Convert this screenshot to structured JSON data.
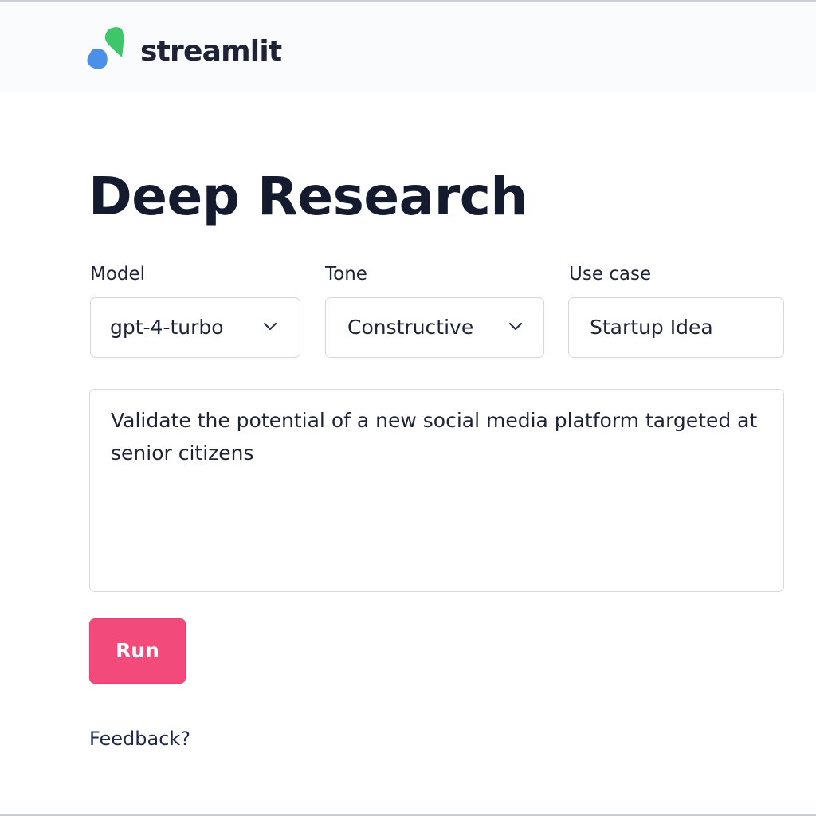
{
  "header": {
    "brand": "streamlit",
    "logo_icon": "streamlit-logo-icon",
    "logo_colors": [
      "#3ec66b",
      "#4a8fe8"
    ]
  },
  "main": {
    "title": "Deep Research",
    "fields": [
      {
        "label": "Model",
        "value": "gpt-4-turbo",
        "type": "select",
        "icon": "chevron-down-icon"
      },
      {
        "label": "Tone",
        "value": "Constructive",
        "type": "select",
        "icon": "chevron-down-icon"
      },
      {
        "label": "Use case",
        "value": "Startup Idea",
        "type": "text"
      }
    ],
    "prompt": "Validate the potential of a new social media platform targeted at senior citizens",
    "run_label": "Run",
    "feedback_label": "Feedback?"
  },
  "colors": {
    "accent": "#f24b7b",
    "text": "#1e2436",
    "border": "#d5d9df"
  }
}
